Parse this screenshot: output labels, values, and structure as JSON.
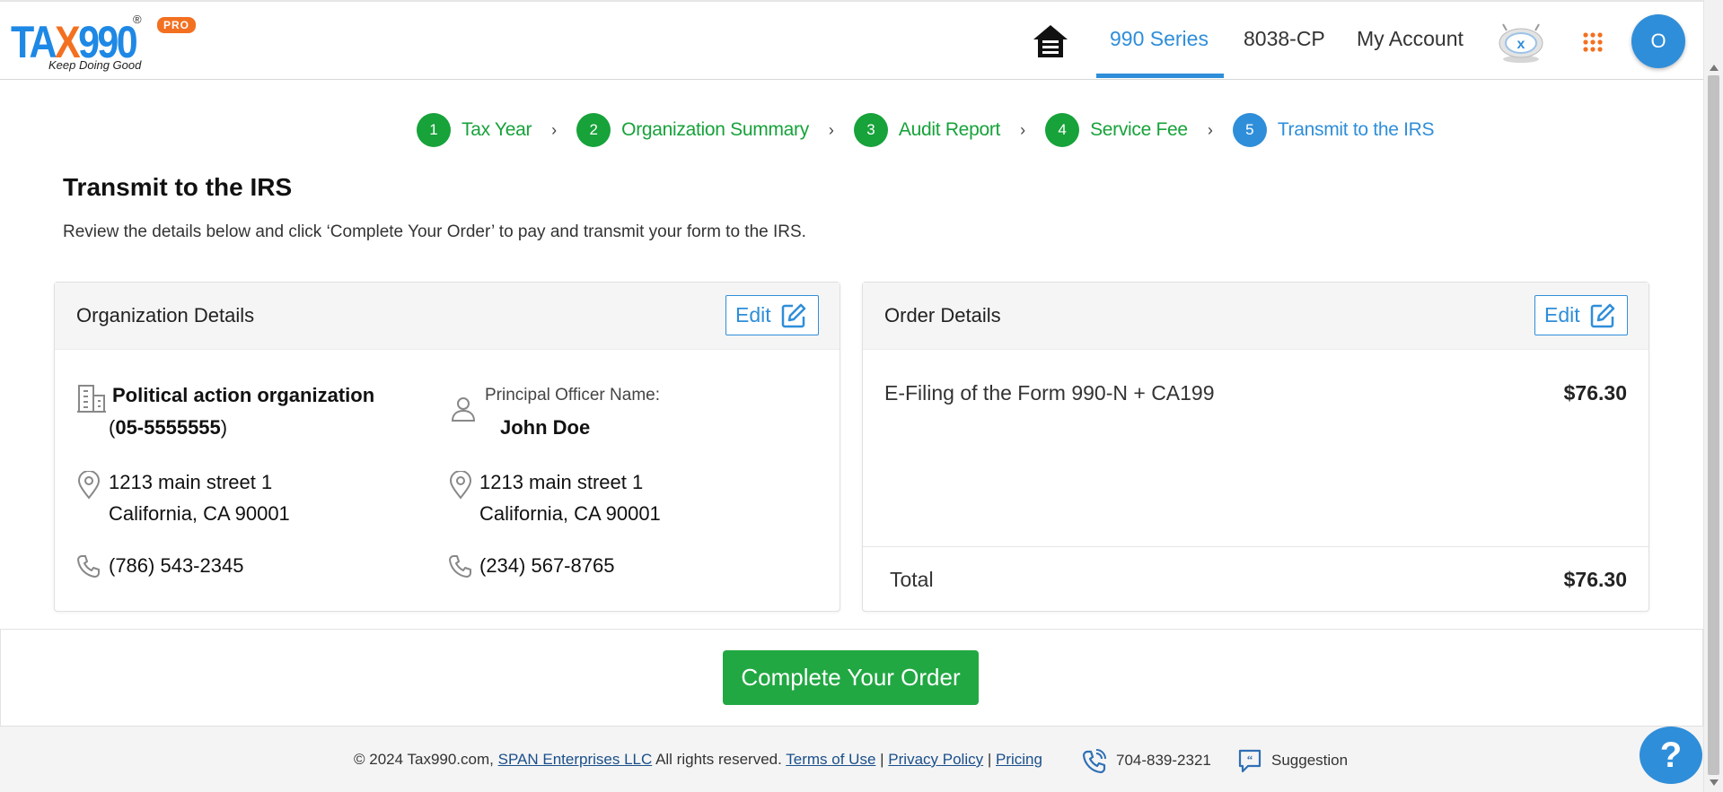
{
  "header": {
    "logo_text_pre": "TA",
    "logo_text_x": "X",
    "logo_text_post": "990",
    "logo_reg": "®",
    "logo_pro": "PRO",
    "logo_tagline": "Keep Doing Good",
    "nav": [
      {
        "label": "990 Series",
        "active": true
      },
      {
        "label": "8038-CP",
        "active": false
      },
      {
        "label": "My Account",
        "active": false
      }
    ],
    "avatar_initial": "O",
    "icons": [
      "home-icon",
      "taxbot-icon",
      "apps-grid-icon"
    ]
  },
  "stepper": {
    "steps": [
      {
        "num": "1",
        "label": "Tax Year",
        "state": "complete"
      },
      {
        "num": "2",
        "label": "Organization Summary",
        "state": "complete"
      },
      {
        "num": "3",
        "label": "Audit Report",
        "state": "complete"
      },
      {
        "num": "4",
        "label": "Service Fee",
        "state": "complete"
      },
      {
        "num": "5",
        "label": "Transmit to the IRS",
        "state": "active"
      }
    ],
    "separator": "›"
  },
  "page": {
    "title": "Transmit to the IRS",
    "description": "Review the details below and click ‘Complete Your Order’ to pay and transmit your form to the IRS."
  },
  "org_card": {
    "title": "Organization Details",
    "edit_label": "Edit",
    "org_name": "Political action organization",
    "ein_open": "(",
    "ein": "05-5555555",
    "ein_close": ")",
    "org_address_line1": "1213 main street 1",
    "org_address_line2": "California, CA 90001",
    "org_phone": "(786) 543-2345",
    "officer_label": "Principal Officer Name:",
    "officer_name": "John Doe",
    "officer_address_line1": "1213 main street 1",
    "officer_address_line2": "California, CA 90001",
    "officer_phone": "(234) 567-8765"
  },
  "order_card": {
    "title": "Order Details",
    "edit_label": "Edit",
    "items": [
      {
        "label": "E-Filing of the Form 990-N + CA199",
        "amount": "$76.30"
      }
    ],
    "total_label": "Total",
    "total_amount": "$76.30"
  },
  "action": {
    "complete_label": "Complete Your Order"
  },
  "footer": {
    "copyright": "© 2024 Tax990.com,",
    "company_link": "SPAN Enterprises LLC",
    "rights": "All rights reserved.",
    "terms_link": "Terms of Use",
    "sep": "|",
    "privacy_link": "Privacy Policy",
    "pricing_link": "Pricing",
    "phone": "704-839-2321",
    "suggestion": "Suggestion"
  },
  "help_label": "?",
  "colors": {
    "primary_blue": "#2f8ed9",
    "step_green": "#17a23a",
    "button_green": "#22a843",
    "logo_orange": "#f37021"
  }
}
